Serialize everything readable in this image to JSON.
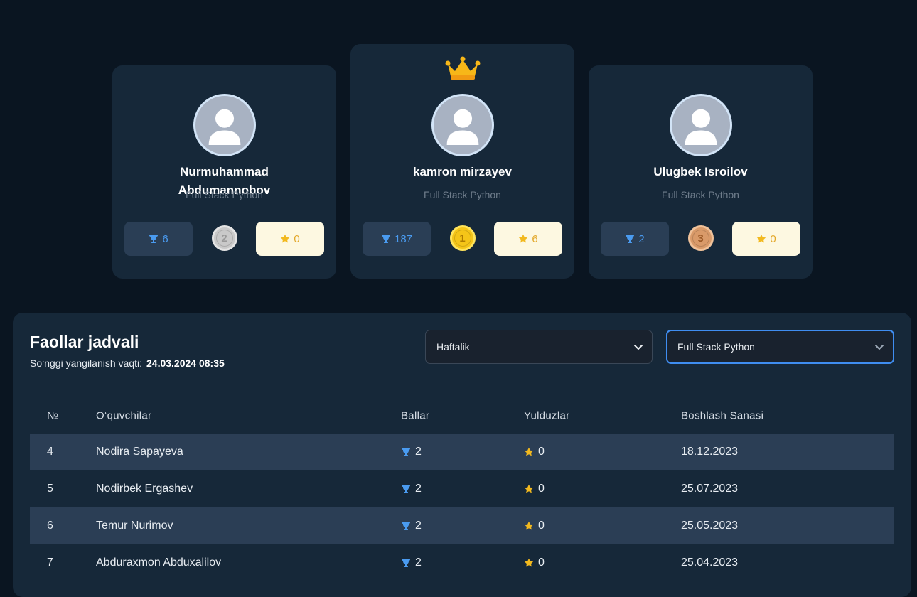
{
  "podium": [
    {
      "position": "left",
      "name": "Nurmuhammad Abdumannobov",
      "course": "Full Stack Python",
      "trophies": "6",
      "rank": "2",
      "stars": "0"
    },
    {
      "position": "center",
      "name": "kamron mirzayev",
      "course": "Full Stack Python",
      "trophies": "187",
      "rank": "1",
      "stars": "6"
    },
    {
      "position": "right",
      "name": "Ulugbek Isroilov",
      "course": "Full Stack Python",
      "trophies": "2",
      "rank": "3",
      "stars": "0"
    }
  ],
  "leaderboard": {
    "title": "Faollar jadvali",
    "updated_label": "So‘nggi yangilanish vaqti:",
    "updated_value": "24.03.2024 08:35",
    "period_select": "Haftalik",
    "course_select": "Full Stack Python",
    "columns": {
      "num": "№",
      "students": "O‘quvchilar",
      "points": "Ballar",
      "stars": "Yulduzlar",
      "start_date": "Boshlash Sanasi"
    },
    "rows": [
      {
        "num": "4",
        "name": "Nodira Sapayeva",
        "points": "2",
        "stars": "0",
        "date": "18.12.2023"
      },
      {
        "num": "5",
        "name": "Nodirbek Ergashev",
        "points": "2",
        "stars": "0",
        "date": "25.07.2023"
      },
      {
        "num": "6",
        "name": "Temur Nurimov",
        "points": "2",
        "stars": "0",
        "date": "25.05.2023"
      },
      {
        "num": "7",
        "name": "Abduraxmon Abduxalilov",
        "points": "2",
        "stars": "0",
        "date": "25.04.2023"
      }
    ]
  },
  "colors": {
    "background": "#0a1521",
    "card": "#162839",
    "accent_blue": "#4a9bf0",
    "star_yellow": "#e3a82a",
    "gold": "#f5c518",
    "silver": "#c9c9c9",
    "bronze": "#d99a69"
  },
  "icons": {
    "crown": "crown-icon",
    "trophy": "trophy-icon",
    "star": "star-icon",
    "avatar": "user-avatar-icon",
    "chevron": "chevron-down-icon"
  }
}
